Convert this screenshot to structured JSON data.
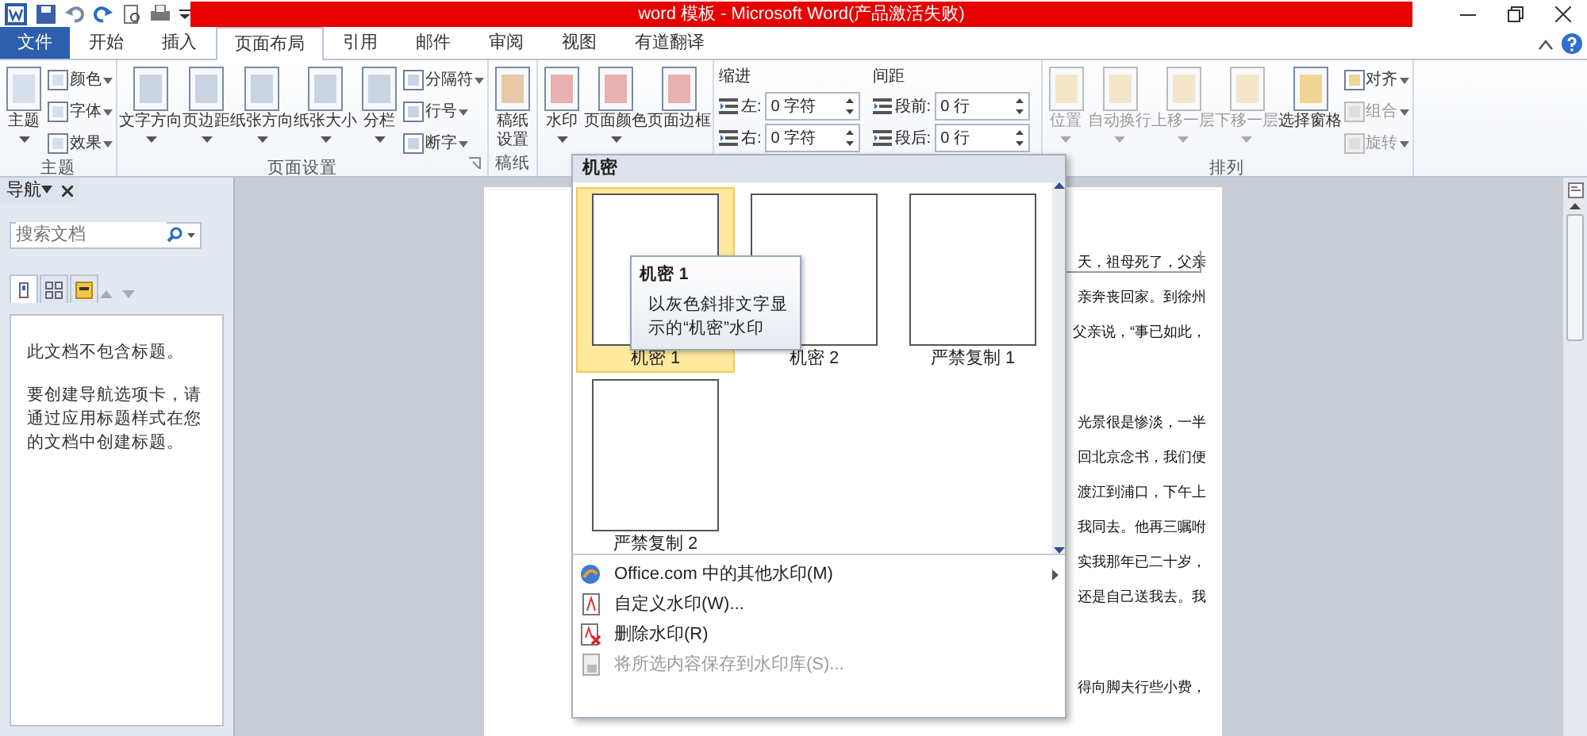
{
  "window": {
    "title": "word 模板 - Microsoft Word(产品激活失败)"
  },
  "tabs": [
    {
      "label": "文件",
      "kind": "file",
      "selected": false
    },
    {
      "label": "开始",
      "kind": "tab",
      "selected": false
    },
    {
      "label": "插入",
      "kind": "tab",
      "selected": false
    },
    {
      "label": "页面布局",
      "kind": "tab",
      "selected": true
    },
    {
      "label": "引用",
      "kind": "tab",
      "selected": false
    },
    {
      "label": "邮件",
      "kind": "tab",
      "selected": false
    },
    {
      "label": "审阅",
      "kind": "tab",
      "selected": false
    },
    {
      "label": "视图",
      "kind": "tab",
      "selected": false
    },
    {
      "label": "有道翻译",
      "kind": "tab",
      "selected": false
    }
  ],
  "ribbon": {
    "groups": [
      {
        "label": "主题",
        "launcher": false,
        "items": [
          {
            "kind": "large",
            "label": "主题",
            "dropdown": true,
            "disabled": false
          },
          {
            "kind": "small",
            "label": "颜色",
            "dropdown": true,
            "disabled": false
          },
          {
            "kind": "small",
            "label": "字体",
            "dropdown": true,
            "disabled": false
          },
          {
            "kind": "small",
            "label": "效果",
            "dropdown": true,
            "disabled": false
          }
        ]
      },
      {
        "label": "页面设置",
        "launcher": true,
        "items": [
          {
            "kind": "large",
            "label": "文字方向",
            "dropdown": true,
            "disabled": false
          },
          {
            "kind": "large",
            "label": "页边距",
            "dropdown": true,
            "disabled": false
          },
          {
            "kind": "large",
            "label": "纸张方向",
            "dropdown": true,
            "disabled": false
          },
          {
            "kind": "large",
            "label": "纸张大小",
            "dropdown": true,
            "disabled": false
          },
          {
            "kind": "large",
            "label": "分栏",
            "dropdown": true,
            "disabled": false
          },
          {
            "kind": "small",
            "label": "分隔符",
            "dropdown": true,
            "disabled": false
          },
          {
            "kind": "small",
            "label": "行号",
            "dropdown": true,
            "disabled": false
          },
          {
            "kind": "small",
            "label": "断字",
            "dropdown": true,
            "disabled": false
          }
        ]
      },
      {
        "label": "稿纸",
        "launcher": false,
        "items": [
          {
            "kind": "large_wrapped",
            "label": "稿纸设置",
            "dropdown": false,
            "disabled": false
          }
        ]
      },
      {
        "items": [
          {
            "kind": "large",
            "label": "水印",
            "dropdown": true,
            "disabled": false
          },
          {
            "kind": "large",
            "label": "页面颜色",
            "dropdown": true,
            "disabled": false
          },
          {
            "kind": "large",
            "label": "页面边框",
            "dropdown": false,
            "disabled": false
          }
        ]
      },
      {
        "items": [
          {
            "kind": "spinners",
            "heading": "缩进",
            "fields": [
              {
                "label": "左:",
                "value": "0 字符"
              },
              {
                "label": "右:",
                "value": "0 字符"
              }
            ]
          },
          {
            "kind": "spinners",
            "heading": "间距",
            "fields": [
              {
                "label": "段前:",
                "value": "0 行"
              },
              {
                "label": "段后:",
                "value": "0 行"
              }
            ]
          }
        ]
      },
      {
        "label": "排列",
        "launcher": false,
        "items": [
          {
            "kind": "large",
            "label": "位置",
            "dropdown": true,
            "disabled": true
          },
          {
            "kind": "large",
            "label": "自动换行",
            "dropdown": true,
            "disabled": true
          },
          {
            "kind": "large",
            "label": "上移一层",
            "dropdown": true,
            "disabled": true
          },
          {
            "kind": "large",
            "label": "下移一层",
            "dropdown": true,
            "disabled": true
          },
          {
            "kind": "large",
            "label": "选择窗格",
            "dropdown": false,
            "disabled": false
          },
          {
            "kind": "small",
            "label": "对齐",
            "dropdown": true,
            "disabled": false
          },
          {
            "kind": "small",
            "label": "组合",
            "dropdown": true,
            "disabled": true
          },
          {
            "kind": "small",
            "label": "旋转",
            "dropdown": true,
            "disabled": true
          }
        ]
      }
    ]
  },
  "navigation": {
    "title": "导航",
    "search": {
      "placeholder": "搜索文档"
    },
    "view_tabs": [
      {
        "selected": true
      },
      {
        "selected": false
      },
      {
        "selected": false
      }
    ],
    "messages": [
      "此文档不包含标题。",
      "要创建导航选项卡，请通过应用标题样式在您的文档中创建标题。"
    ]
  },
  "document": {
    "paragraphs": [
      {
        "lines": [
          "天，祖母死了，父亲",
          "亲奔丧回家。到徐州",
          "父亲说，“事已如此，"
        ]
      },
      {
        "lines": [
          "光景很是惨淡，一半",
          "回北京念书，我们便",
          "渡江到浦口，下午上",
          "我同去。他再三嘱咐",
          "实我那年已二十岁，",
          "还是自己送我去。我"
        ]
      },
      {
        "lines": [
          "得向脚夫行些小费，"
        ]
      }
    ]
  },
  "watermark_menu": {
    "category": "机密",
    "gallery": [
      {
        "label": "机密 1",
        "selected": true
      },
      {
        "label": "机密 2",
        "selected": false
      },
      {
        "label": "严禁复制 1",
        "selected": false
      },
      {
        "label": "严禁复制 2",
        "selected": false
      }
    ],
    "tooltip": {
      "title": "机密 1",
      "text": "以灰色斜排文字显示的“机密”水印"
    },
    "commands": [
      {
        "label": "Office.com 中的其他水印(M)",
        "submenu": true,
        "disabled": false
      },
      {
        "label": "自定义水印(W)...",
        "submenu": false,
        "disabled": false
      },
      {
        "label": "删除水印(R)",
        "submenu": false,
        "disabled": false
      },
      {
        "label": "将所选内容保存到水印库(S)...",
        "submenu": false,
        "disabled": true
      }
    ]
  }
}
